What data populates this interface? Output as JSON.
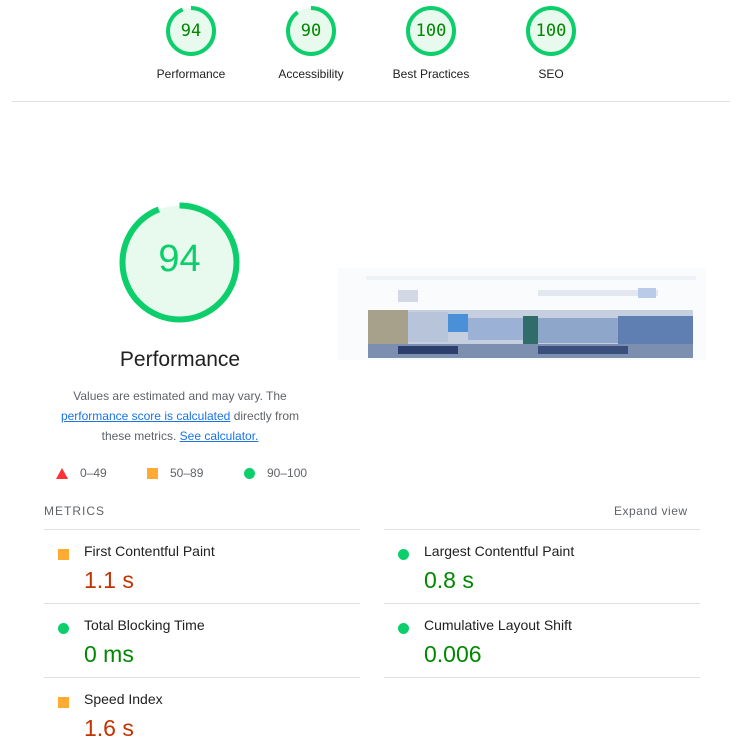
{
  "summary_gauges": [
    {
      "score": "94",
      "label": "Performance"
    },
    {
      "score": "90",
      "label": "Accessibility"
    },
    {
      "score": "100",
      "label": "Best Practices"
    },
    {
      "score": "100",
      "label": "SEO"
    }
  ],
  "performance": {
    "score": "94",
    "title": "Performance",
    "desc_prefix": "Values are estimated and may vary. The",
    "score_link": "performance score is calculated",
    "desc_middle": "directly from these metrics.",
    "calculator_link": "See calculator."
  },
  "legend": {
    "fail": "0–49",
    "average": "50–89",
    "pass": "90–100"
  },
  "metrics": {
    "title": "METRICS",
    "expand_label": "Expand view",
    "items": [
      {
        "name": "First Contentful Paint",
        "value": "1.1 s",
        "rating": "average"
      },
      {
        "name": "Largest Contentful Paint",
        "value": "0.8 s",
        "rating": "pass"
      },
      {
        "name": "Total Blocking Time",
        "value": "0 ms",
        "rating": "pass"
      },
      {
        "name": "Cumulative Layout Shift",
        "value": "0.006",
        "rating": "pass"
      },
      {
        "name": "Speed Index",
        "value": "1.6 s",
        "rating": "average"
      }
    ]
  },
  "colors": {
    "pass": "#0cce6b",
    "pass_text": "#008800",
    "average": "#ffaa33",
    "average_text": "#c33300",
    "fail": "#ff3333"
  }
}
